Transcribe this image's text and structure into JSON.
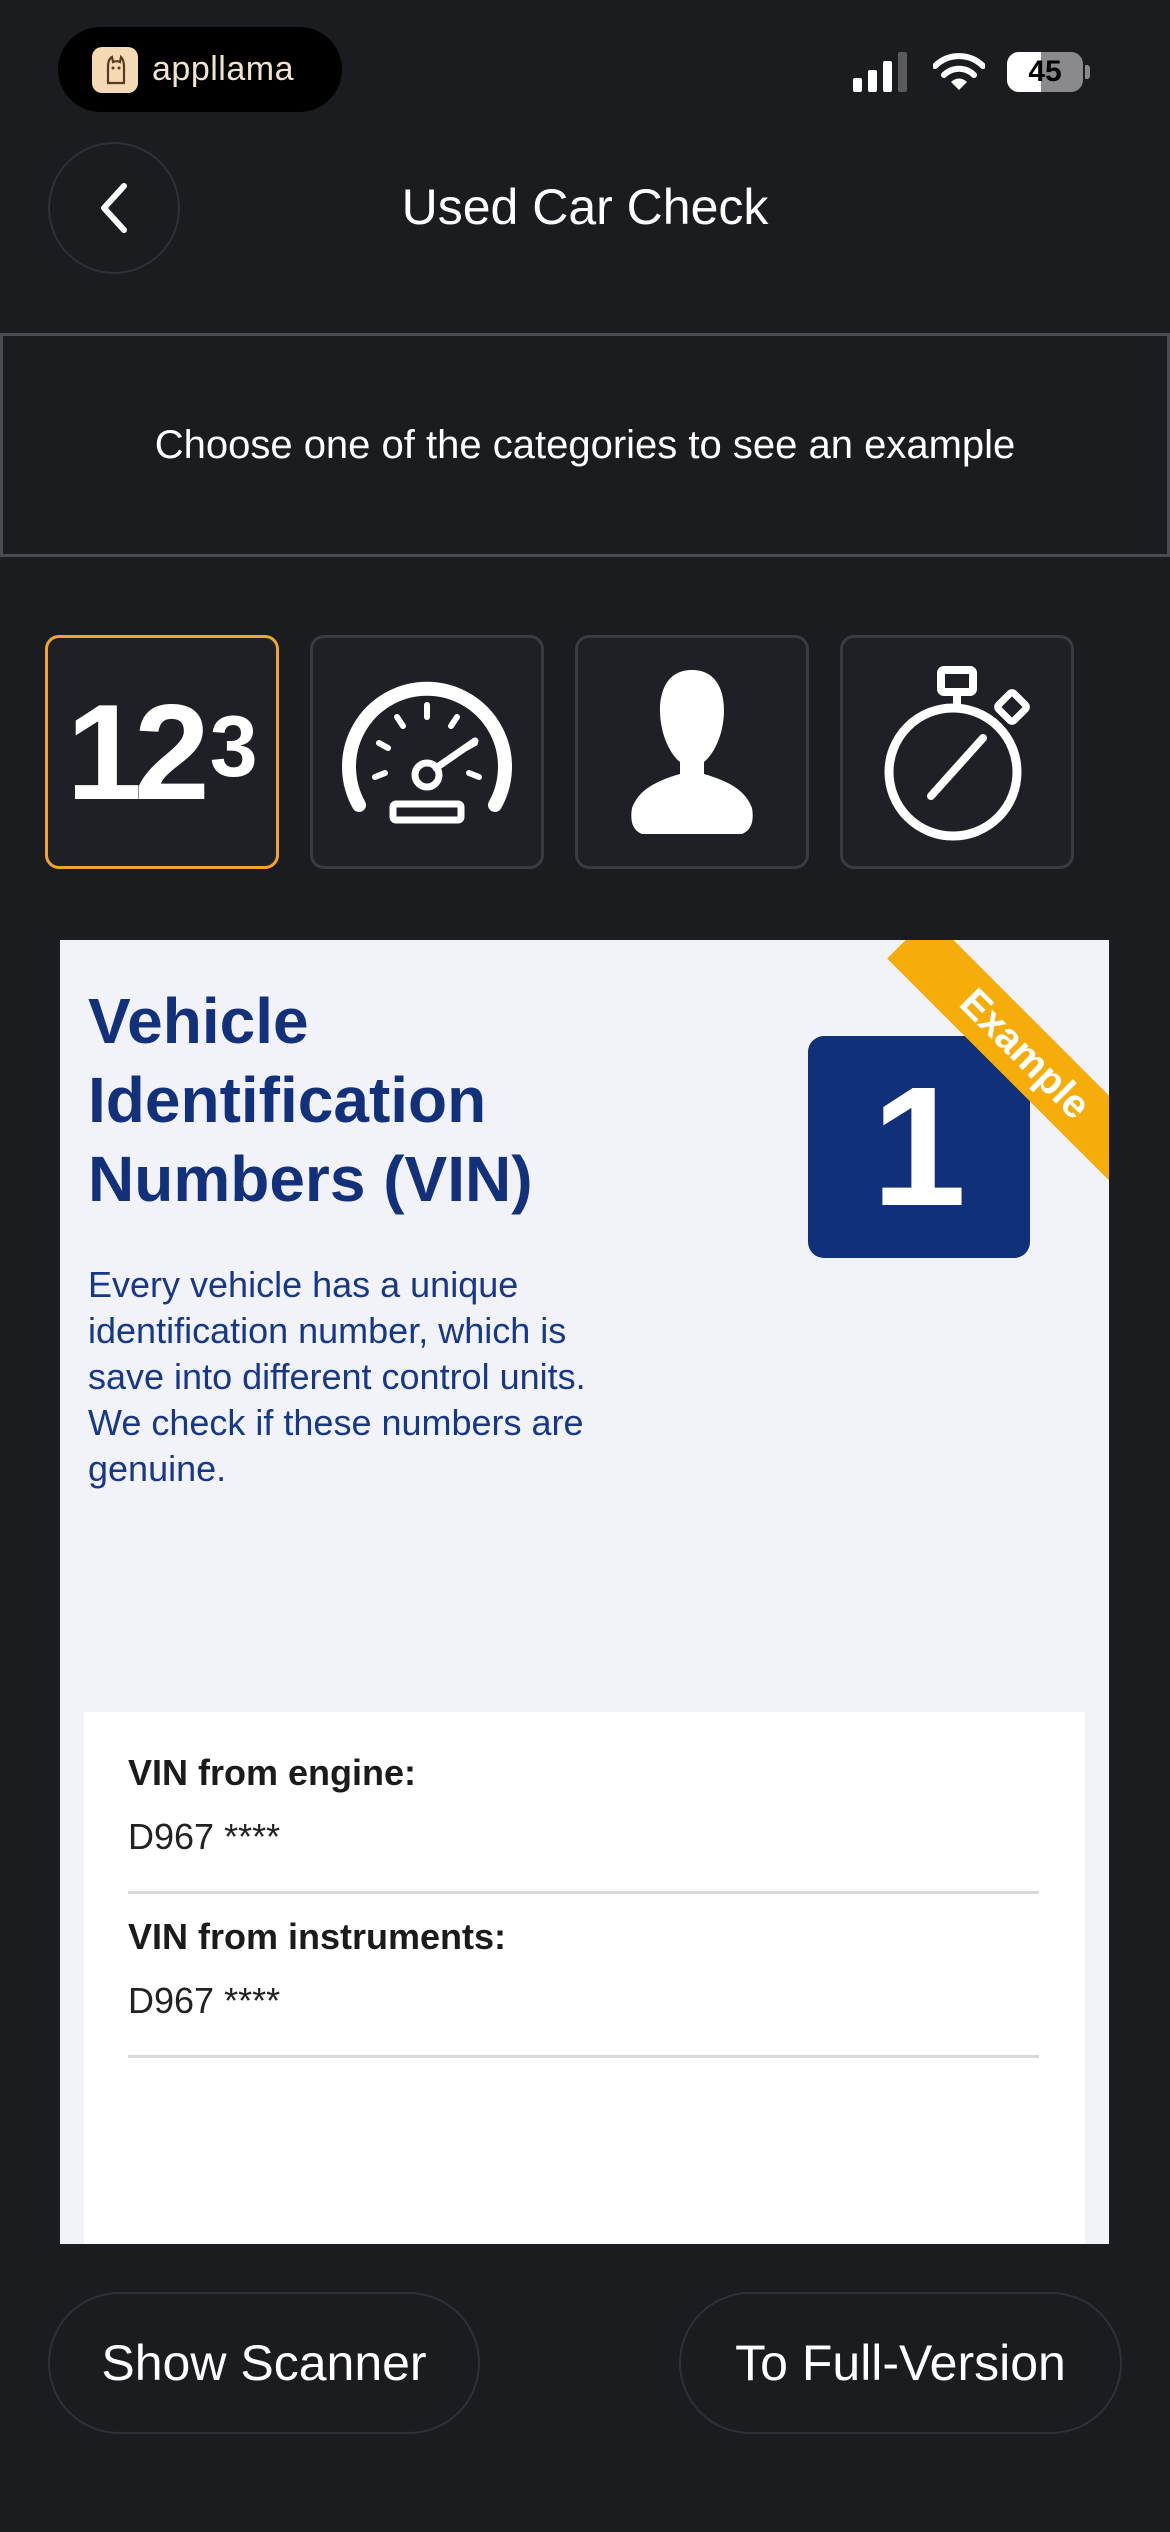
{
  "status_bar": {
    "app_name": "appllama",
    "battery_level": "45",
    "battery_fraction": 0.45
  },
  "header": {
    "title": "Used Car Check"
  },
  "hint": {
    "text": "Choose one of the categories to see an example"
  },
  "categories": [
    {
      "icon": "vin-number-icon",
      "big": "12",
      "small": "3",
      "selected": true
    },
    {
      "icon": "speedometer-icon",
      "selected": false
    },
    {
      "icon": "person-icon",
      "selected": false
    },
    {
      "icon": "stopwatch-icon",
      "selected": false
    }
  ],
  "example_card": {
    "title_lines": [
      "Vehicle",
      "Identification",
      "Numbers (VIN)"
    ],
    "badge_number": "1",
    "ribbon_label": "Example",
    "description_lines": [
      "Every vehicle has a unique",
      "identification number, which is",
      "save into different control units.",
      "We check if these numbers are",
      "genuine."
    ],
    "rows": [
      {
        "label": "VIN from engine:",
        "value": "D967 ****"
      },
      {
        "label": "VIN from instruments:",
        "value": "D967 ****"
      }
    ]
  },
  "buttons": {
    "scanner": "Show Scanner",
    "full_version": "To Full-Version"
  },
  "colors": {
    "background": "#1b1c20",
    "selected_border": "#f0a431",
    "card_title": "#13307a",
    "ribbon": "#f6ad0a"
  }
}
